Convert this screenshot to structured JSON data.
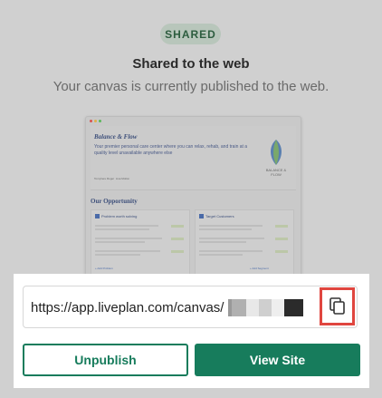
{
  "status_badge": "SHARED",
  "title": "Shared to the web",
  "subtitle": "Your canvas is currently published to the web.",
  "preview": {
    "heading": "Balance & Flow",
    "description": "Your premier personal care center where you can relax, rehab, and train at a quality level unavailable anywhere else",
    "meta": [
      "Tomyhere Roger",
      "Lisa Mollon"
    ],
    "logo_text": "BALANCE & FLOW",
    "section_title": "Our Opportunity",
    "cards": [
      {
        "number": "1",
        "heading": "Problem worth solving",
        "footer": "+ Add Problem"
      },
      {
        "number": "2",
        "heading": "Target Customers",
        "footer": "+ Add Segment"
      }
    ]
  },
  "share": {
    "url": "https://app.liveplan.com/canvas/",
    "copy_icon": "copy-icon"
  },
  "buttons": {
    "unpublish": "Unpublish",
    "view_site": "View Site"
  },
  "colors": {
    "accent": "#177c5c",
    "highlight": "#e0463f",
    "badge_bg": "#b8c6bb"
  }
}
